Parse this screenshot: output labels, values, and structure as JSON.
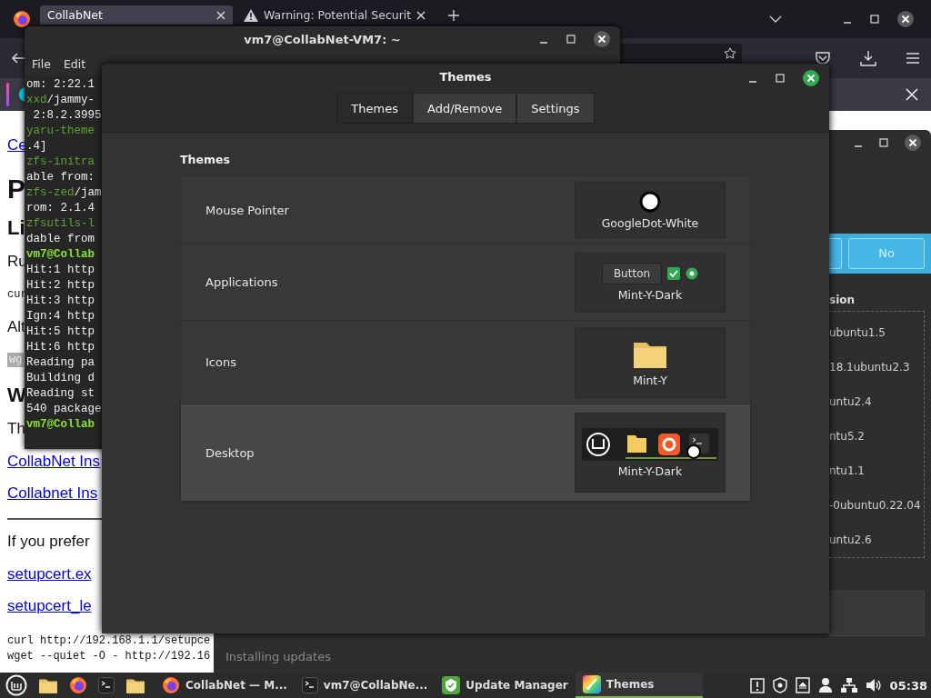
{
  "browser": {
    "tabs": [
      {
        "title": "CollabNet",
        "selected": true,
        "kind": "plain"
      },
      {
        "title": "Warning: Potential Securit",
        "selected": false,
        "kind": "warning"
      }
    ],
    "page": [
      {
        "kind": "link",
        "text": "Ce"
      },
      {
        "kind": "h1",
        "text": "P"
      },
      {
        "kind": "h2",
        "text": "Li"
      },
      {
        "kind": "p",
        "text": "Ru"
      },
      {
        "kind": "code",
        "text": "cur"
      },
      {
        "kind": "p",
        "text": "Alt"
      },
      {
        "kind": "codebox",
        "text": "wg"
      },
      {
        "kind": "h2",
        "text": "W"
      },
      {
        "kind": "p",
        "text": "Th"
      },
      {
        "kind": "link",
        "text": "CollabNet Ins"
      },
      {
        "kind": "link",
        "text": "Collabnet Ins"
      },
      {
        "kind": "rule"
      },
      {
        "kind": "p",
        "text": "If you prefer"
      },
      {
        "kind": "link",
        "text": "setupcert.ex"
      },
      {
        "kind": "link",
        "text": "setupcert_le"
      },
      {
        "kind": "pre",
        "text": "curl http://192.168.1.1/setupce"
      },
      {
        "kind": "pre",
        "text": "wget --quiet -O - http://192.16"
      }
    ]
  },
  "update_manager": {
    "buttons": [
      "No"
    ],
    "column_header": "sion",
    "versions": [
      "ubuntu1.5",
      "18.1ubuntu2.3",
      "untu2.4",
      "ntu5.2",
      "ntu1.1",
      "-0ubuntu0.22.04",
      "untu2.6"
    ],
    "status": "Installing updates"
  },
  "terminal": {
    "title": "vm7@CollabNet-VM7: ~",
    "menu": [
      "File",
      "Edit"
    ],
    "lines": [
      [
        {
          "kind": "plain",
          "text": "om: 2:22.1"
        }
      ],
      [
        {
          "kind": "pkg",
          "text": "xxd"
        },
        {
          "kind": "plain",
          "text": "/jammy-"
        }
      ],
      [
        {
          "kind": "plain",
          "text": " 2:8.2.3995"
        }
      ],
      [
        {
          "kind": "pkg",
          "text": "yaru-theme"
        }
      ],
      [
        {
          "kind": "plain",
          "text": ".4]"
        }
      ],
      [
        {
          "kind": "pkg",
          "text": "zfs-initra"
        }
      ],
      [
        {
          "kind": "plain",
          "text": "able from:"
        }
      ],
      [
        {
          "kind": "pkg",
          "text": "zfs-zed"
        },
        {
          "kind": "plain",
          "text": "/jam"
        }
      ],
      [
        {
          "kind": "plain",
          "text": "rom: 2.1.4"
        }
      ],
      [
        {
          "kind": "pkg",
          "text": "zfsutils-l"
        }
      ],
      [
        {
          "kind": "plain",
          "text": "dable from"
        }
      ],
      [
        {
          "kind": "prompt",
          "text": "vm7@Collab"
        }
      ],
      [
        {
          "kind": "plain",
          "text": "Hit:1 http"
        }
      ],
      [
        {
          "kind": "plain",
          "text": "Hit:2 http"
        }
      ],
      [
        {
          "kind": "plain",
          "text": "Hit:3 http"
        }
      ],
      [
        {
          "kind": "plain",
          "text": "Ign:4 http"
        }
      ],
      [
        {
          "kind": "plain",
          "text": "Hit:5 http"
        }
      ],
      [
        {
          "kind": "plain",
          "text": "Hit:6 http"
        }
      ],
      [
        {
          "kind": "plain",
          "text": "Reading pa"
        }
      ],
      [
        {
          "kind": "plain",
          "text": "Building d"
        }
      ],
      [
        {
          "kind": "plain",
          "text": "Reading st"
        }
      ],
      [
        {
          "kind": "plain",
          "text": "540 package"
        }
      ],
      [
        {
          "kind": "prompt",
          "text": "vm7@Collab"
        }
      ]
    ]
  },
  "themes": {
    "title": "Themes",
    "tabs": [
      {
        "label": "Themes",
        "selected": true
      },
      {
        "label": "Add/Remove",
        "selected": false
      },
      {
        "label": "Settings",
        "selected": false
      }
    ],
    "section": "Themes",
    "rows": [
      {
        "label": "Mouse Pointer",
        "value": "GoogleDot-White",
        "kind": "pointer",
        "selected": false
      },
      {
        "label": "Applications",
        "value": "Mint-Y-Dark",
        "kind": "applications",
        "sample_button": "Button",
        "selected": false
      },
      {
        "label": "Icons",
        "value": "Mint-Y",
        "kind": "icons",
        "selected": false
      },
      {
        "label": "Desktop",
        "value": "Mint-Y-Dark",
        "kind": "desktop",
        "selected": true
      }
    ]
  },
  "taskbar": {
    "windows": [
      {
        "title": "CollabNet — M...",
        "kind": "browser",
        "active": false
      },
      {
        "title": "vm7@CollabNe...",
        "kind": "terminal",
        "active": false
      },
      {
        "title": "Update Manager",
        "kind": "updates",
        "active": false
      },
      {
        "title": "Themes",
        "kind": "themes",
        "active": true
      }
    ],
    "clock": "05:38"
  }
}
